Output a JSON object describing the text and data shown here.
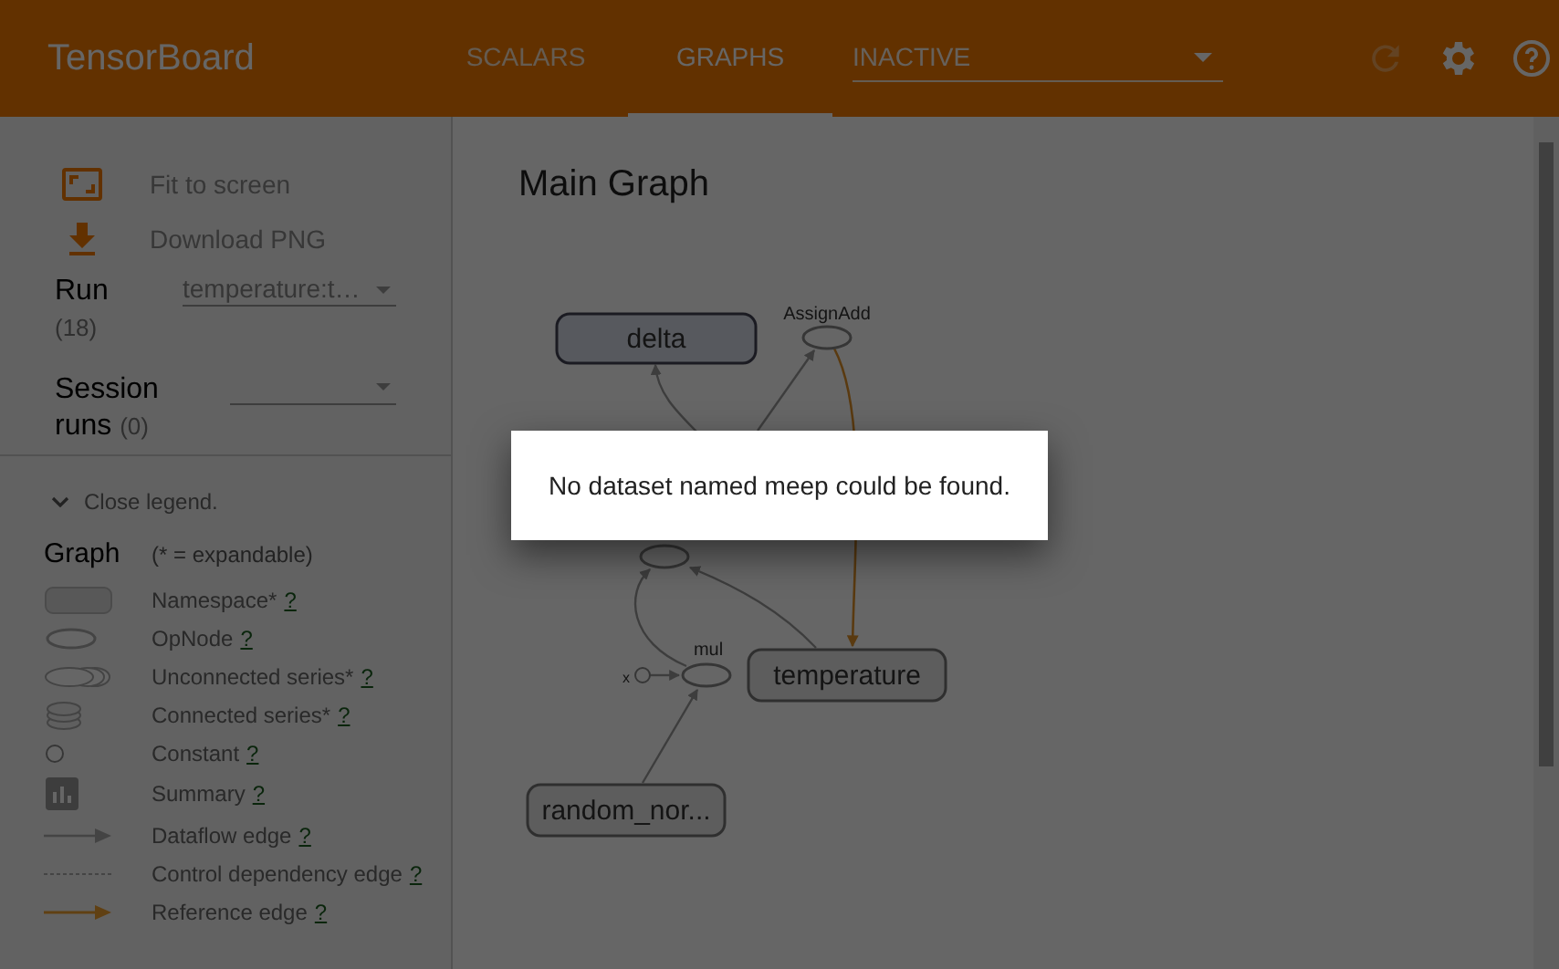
{
  "header": {
    "title": "TensorBoard",
    "tabs": [
      {
        "label": "SCALARS",
        "selected": false
      },
      {
        "label": "GRAPHS",
        "selected": true
      }
    ],
    "dropdown": {
      "value": "INACTIVE"
    },
    "reload": {
      "disabled": true
    }
  },
  "sidebar": {
    "actions": [
      {
        "kind": "fit",
        "label": "Fit to screen"
      },
      {
        "kind": "download",
        "label": "Download PNG"
      }
    ],
    "run": {
      "label": "Run",
      "count": "(18)",
      "value": "temperature:t…"
    },
    "session_runs": {
      "label": "Session runs",
      "count": "(0)"
    },
    "legend": {
      "toggle": "Close legend.",
      "title": "Graph",
      "note": "(* = expandable)",
      "items": [
        {
          "kind": "namespace",
          "label": "Namespace*",
          "help": "?"
        },
        {
          "kind": "opnode",
          "label": "OpNode",
          "help": "?"
        },
        {
          "kind": "unconnected",
          "label": "Unconnected series*",
          "help": "?"
        },
        {
          "kind": "connected",
          "label": "Connected series*",
          "help": "?"
        },
        {
          "kind": "constant",
          "label": "Constant",
          "help": "?"
        },
        {
          "kind": "summary",
          "label": "Summary",
          "help": "?"
        },
        {
          "kind": "dataflow",
          "label": "Dataflow edge",
          "help": "?"
        },
        {
          "kind": "control",
          "label": "Control dependency edge",
          "help": "?"
        },
        {
          "kind": "reference",
          "label": "Reference edge",
          "help": "?"
        }
      ]
    }
  },
  "main": {
    "title": "Main Graph",
    "graph": {
      "nodes": [
        {
          "kind": "namespace",
          "label": "delta"
        },
        {
          "kind": "op",
          "label": "AssignAdd"
        },
        {
          "kind": "op"
        },
        {
          "kind": "op",
          "label": "mul"
        },
        {
          "kind": "constant",
          "label": "x"
        },
        {
          "kind": "namespace",
          "label": "temperature"
        },
        {
          "kind": "namespace",
          "label": "random_nor..."
        }
      ]
    }
  },
  "dialog": {
    "message": "No dataset named meep could be found."
  }
}
